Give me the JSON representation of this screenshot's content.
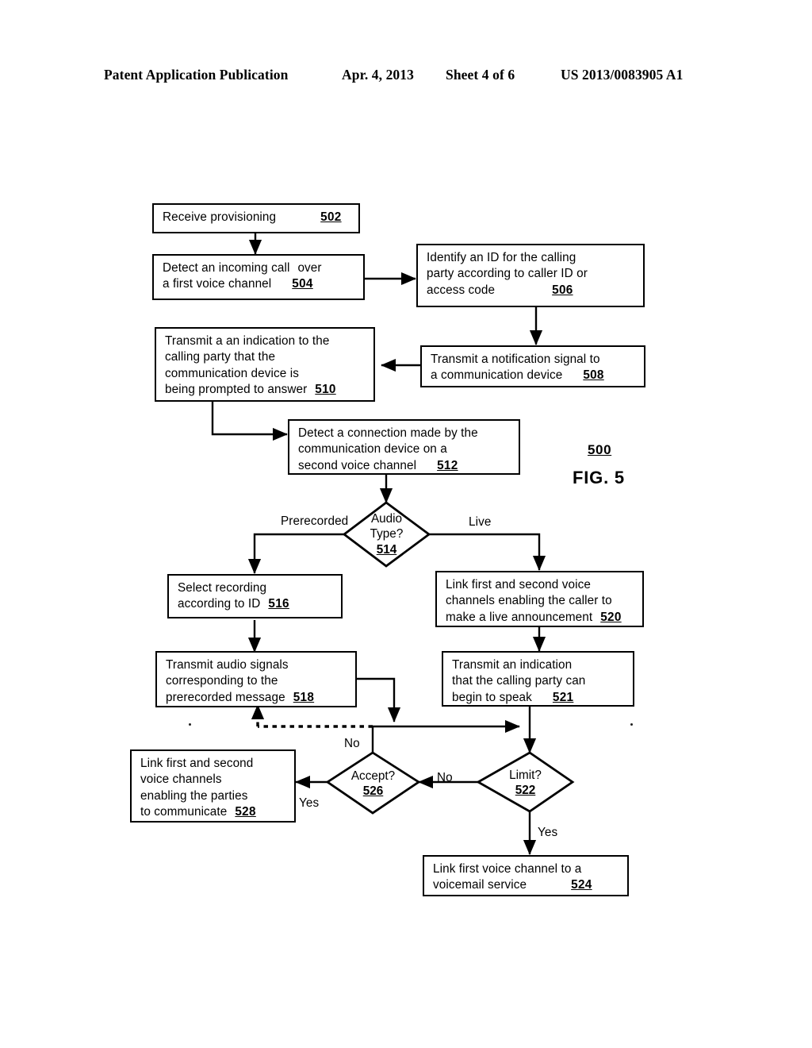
{
  "header": {
    "publication": "Patent Application Publication",
    "date": "Apr. 4, 2013",
    "sheet": "Sheet 4 of 6",
    "document_number": "US 2013/0083905 A1"
  },
  "figure": {
    "reference_numeral": "500",
    "caption": "FIG. 5"
  },
  "nodes": {
    "n502": {
      "line1": "Receive provisioning",
      "ref": "502"
    },
    "n504": {
      "line1": "Detect an incoming call",
      "line1b": "over",
      "line2": "a first voice channel",
      "ref": "504"
    },
    "n506": {
      "line1": "Identify an ID for the calling",
      "line2": "party according to caller ID or",
      "line3": "access code",
      "ref": "506"
    },
    "n508": {
      "line1": "Transmit a notification signal to",
      "line2": "a communication device",
      "ref": "508"
    },
    "n510": {
      "line1": "Transmit a an indication to the",
      "line2": "calling party that the",
      "line3": "communication device is",
      "line4": "being prompted to answer",
      "ref": "510"
    },
    "n512": {
      "line1": "Detect a connection made by the",
      "line2": "communication device on a",
      "line3": "second voice channel",
      "ref": "512"
    },
    "n514": {
      "line1": "Audio",
      "line2": "Type?",
      "ref": "514"
    },
    "n516": {
      "line1": "Select recording",
      "line2": "according to ID",
      "ref": "516"
    },
    "n518": {
      "line1": "Transmit audio signals",
      "line2": "corresponding to the",
      "line3": "prerecorded message",
      "ref": "518"
    },
    "n520": {
      "line1": "Link first and second voice",
      "line2": "channels enabling the caller to",
      "line3": "make a live announcement",
      "ref": "520"
    },
    "n521": {
      "line1": "Transmit  an indication",
      "line2": "that the calling party can",
      "line3": "begin to speak",
      "ref": "521"
    },
    "n522": {
      "line1": "Limit?",
      "ref": "522"
    },
    "n524": {
      "line1": "Link first voice channel to a",
      "line2": "voicemail service",
      "ref": "524"
    },
    "n526": {
      "line1": "Accept?",
      "ref": "526"
    },
    "n528": {
      "line1": "Link first and second",
      "line2": "voice channels",
      "line3": "enabling the parties",
      "line4": "to communicate",
      "ref": "528"
    }
  },
  "edge_labels": {
    "prerecorded": "Prerecorded",
    "live": "Live",
    "limit_no": "No",
    "limit_yes": "Yes",
    "accept_no": "No",
    "accept_yes": "Yes"
  },
  "colors": {
    "ink": "#000000",
    "paper": "#ffffff"
  }
}
